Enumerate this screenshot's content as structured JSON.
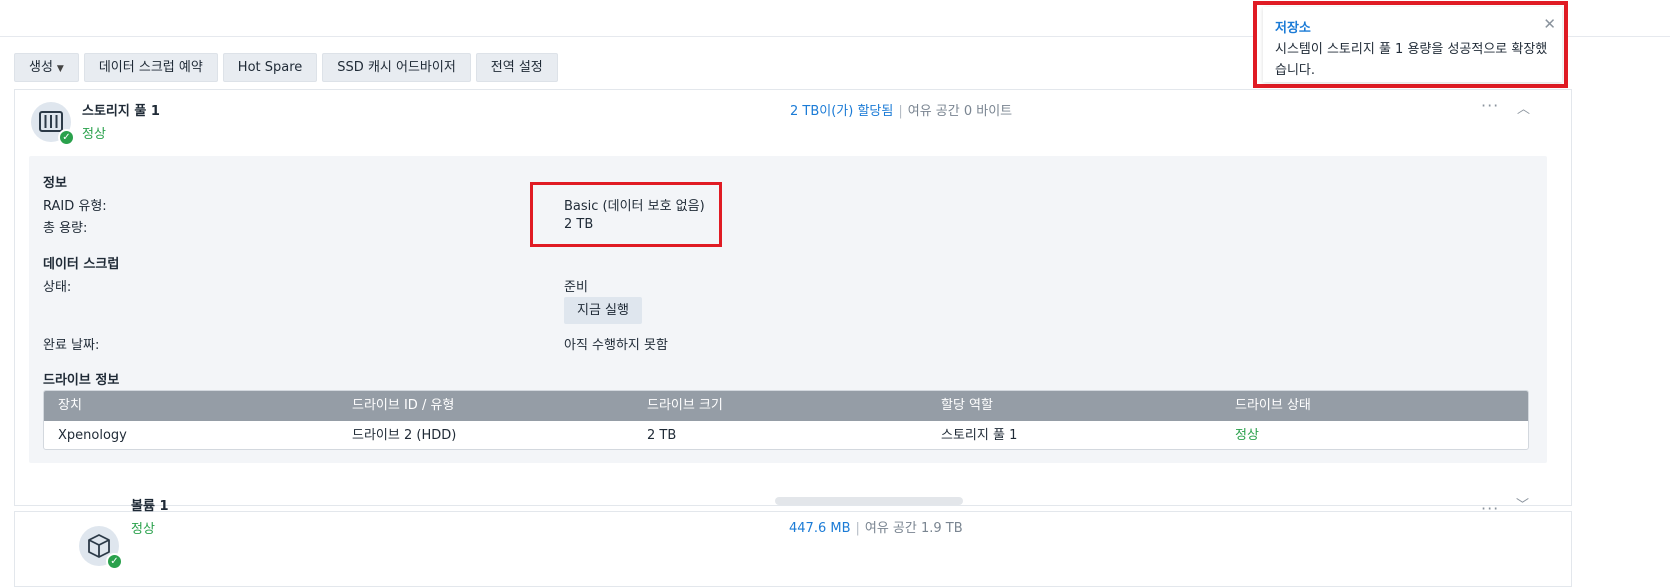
{
  "toolbar": {
    "create_label": "생성",
    "scrub_schedule_label": "데이터 스크럽 예약",
    "hot_spare_label": "Hot Spare",
    "ssd_advisor_label": "SSD 캐시 어드바이저",
    "global_settings_label": "전역 설정"
  },
  "toast": {
    "title": "저장소",
    "message": "시스템이 스토리지 풀 1 용량을 성공적으로 확장했습니다."
  },
  "storage_pool": {
    "name": "스토리지 풀 1",
    "status": "정상",
    "allocated": "2 TB이(가) 할당됨",
    "free": "여유 공간 0 바이트",
    "info_heading": "정보",
    "raid_type_label": "RAID 유형:",
    "raid_type_value": "Basic (데이터 보호 없음)",
    "total_capacity_label": "총 용량:",
    "total_capacity_value": "2 TB",
    "scrub_heading": "데이터 스크럽",
    "scrub_status_label": "상태:",
    "scrub_status_value": "준비",
    "run_now_label": "지금 실행",
    "completion_label": "완료 날짜:",
    "completion_value": "아직 수행하지 못함",
    "drive_info_heading": "드라이브 정보",
    "table": {
      "headers": [
        "장치",
        "드라이브 ID / 유형",
        "드라이브 크기",
        "할당 역할",
        "드라이브 상태"
      ],
      "rows": [
        [
          "Xpenology",
          "드라이브 2 (HDD)",
          "2 TB",
          "스토리지 풀 1",
          "정상"
        ]
      ]
    }
  },
  "volume": {
    "name": "볼륨 1",
    "status": "정상",
    "used": "447.6 MB",
    "free": "여유 공간 1.9 TB",
    "usage_fraction": 0.0
  },
  "colors": {
    "accent": "#1b7bd6",
    "ok": "#2aa14c",
    "highlight": "#e01b24"
  }
}
